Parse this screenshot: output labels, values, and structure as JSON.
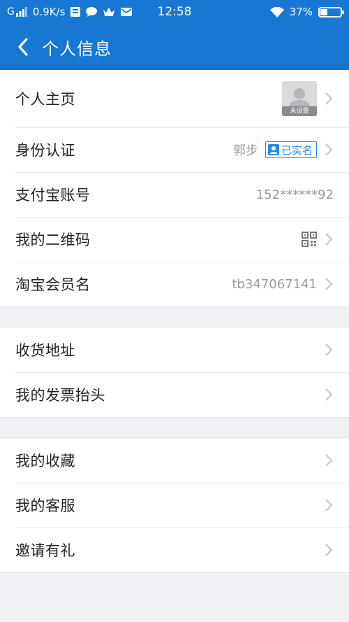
{
  "status_bar": {
    "network": "G",
    "speed": "0.9K/s",
    "time": "12:58",
    "battery": "37%",
    "battery_level": 0.37
  },
  "header": {
    "title": "个人信息"
  },
  "groups": [
    {
      "rows": [
        {
          "label": "个人主页",
          "avatar_tag": "未设置"
        },
        {
          "label": "身份认证",
          "value": "郭步",
          "badge": "已实名"
        },
        {
          "label": "支付宝账号",
          "value": "152******92"
        },
        {
          "label": "我的二维码"
        },
        {
          "label": "淘宝会员名",
          "value": "tb347067141"
        }
      ]
    },
    {
      "rows": [
        {
          "label": "收货地址"
        },
        {
          "label": "我的发票抬头"
        }
      ]
    },
    {
      "rows": [
        {
          "label": "我的收藏"
        },
        {
          "label": "我的客服"
        },
        {
          "label": "邀请有礼"
        }
      ]
    }
  ],
  "icons": {
    "back": "chevron-left-icon",
    "chevron": "chevron-right-icon",
    "qr": "qr-code-icon",
    "verified": "verified-user-icon"
  },
  "colors": {
    "brand": "#1777d2",
    "badge": "#2b8be3"
  }
}
